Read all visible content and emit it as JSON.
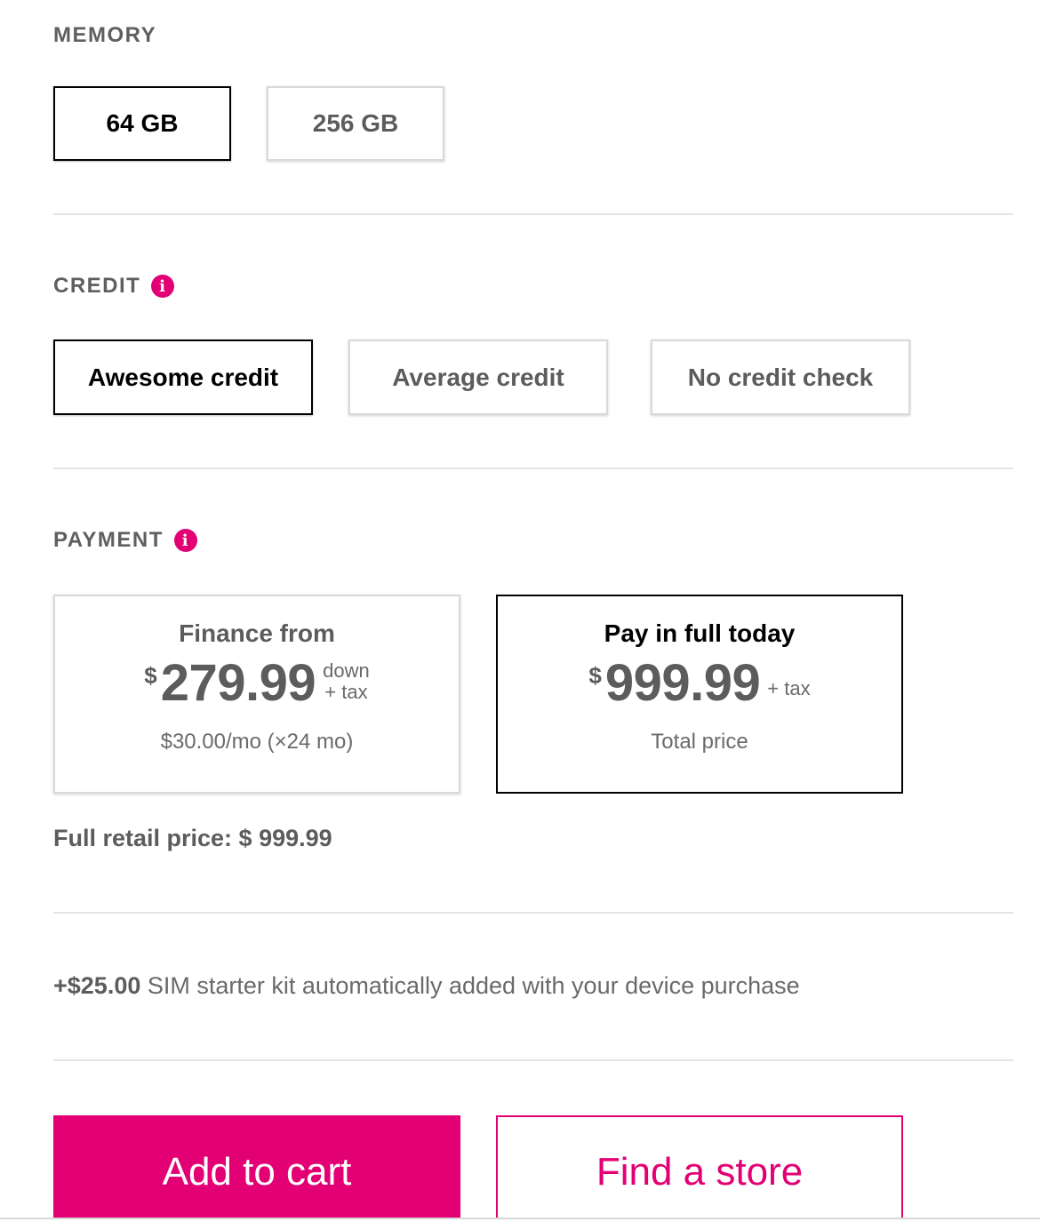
{
  "memory": {
    "label": "MEMORY",
    "options": [
      "64 GB",
      "256 GB"
    ],
    "selected": "64 GB"
  },
  "credit": {
    "label": "CREDIT",
    "info_icon": "info-icon",
    "options": [
      "Awesome credit",
      "Average credit",
      "No credit check"
    ],
    "selected": "Awesome credit"
  },
  "payment": {
    "label": "PAYMENT",
    "info_icon": "info-icon",
    "finance": {
      "title": "Finance from",
      "currency": "$",
      "amount": "279.99",
      "suffix_line1": "down",
      "suffix_line2": "+ tax",
      "sub": "$30.00/mo (×24 mo)"
    },
    "full": {
      "title": "Pay in full today",
      "currency": "$",
      "amount": "999.99",
      "suffix": "+ tax",
      "sub": "Total price"
    },
    "selected": "Pay in full today",
    "retail_price": "Full retail price: $ 999.99"
  },
  "sim": {
    "amount": "+$25.00",
    "text": " SIM starter kit automatically added with your device purchase"
  },
  "actions": {
    "add_to_cart": "Add to cart",
    "find_store": "Find a store"
  },
  "colors": {
    "accent": "#e20074",
    "text": "#5c5c5c",
    "selected_border": "#000000",
    "divider": "#e4e4e4"
  }
}
